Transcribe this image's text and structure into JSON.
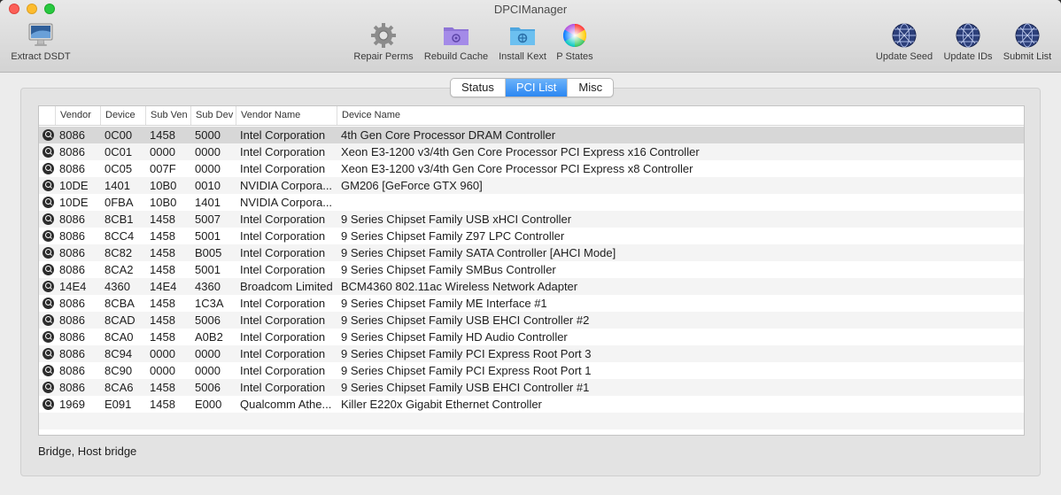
{
  "window": {
    "title": "DPCIManager"
  },
  "toolbar": {
    "extract": "Extract DSDT",
    "repair": "Repair Perms",
    "rebuild": "Rebuild Cache",
    "install": "Install Kext",
    "pstates": "P States",
    "update_seed": "Update Seed",
    "update_ids": "Update IDs",
    "submit": "Submit List"
  },
  "tabs": [
    "Status",
    "PCI List",
    "Misc"
  ],
  "active_tab": "PCI List",
  "table": {
    "columns": [
      "Vendor",
      "Device",
      "Sub Ven",
      "Sub Dev",
      "Vendor Name",
      "Device Name"
    ],
    "rows": [
      [
        "8086",
        "0C00",
        "1458",
        "5000",
        "Intel Corporation",
        "4th Gen Core Processor DRAM Controller"
      ],
      [
        "8086",
        "0C01",
        "0000",
        "0000",
        "Intel Corporation",
        "Xeon E3-1200 v3/4th Gen Core Processor PCI Express x16 Controller"
      ],
      [
        "8086",
        "0C05",
        "007F",
        "0000",
        "Intel Corporation",
        "Xeon E3-1200 v3/4th Gen Core Processor PCI Express x8 Controller"
      ],
      [
        "10DE",
        "1401",
        "10B0",
        "0010",
        "NVIDIA Corpora...",
        "GM206 [GeForce GTX 960]"
      ],
      [
        "10DE",
        "0FBA",
        "10B0",
        "1401",
        "NVIDIA Corpora...",
        ""
      ],
      [
        "8086",
        "8CB1",
        "1458",
        "5007",
        "Intel Corporation",
        "9 Series Chipset Family USB xHCI Controller"
      ],
      [
        "8086",
        "8CC4",
        "1458",
        "5001",
        "Intel Corporation",
        "9 Series Chipset Family Z97 LPC Controller"
      ],
      [
        "8086",
        "8C82",
        "1458",
        "B005",
        "Intel Corporation",
        "9 Series Chipset Family SATA Controller [AHCI Mode]"
      ],
      [
        "8086",
        "8CA2",
        "1458",
        "5001",
        "Intel Corporation",
        "9 Series Chipset Family SMBus Controller"
      ],
      [
        "14E4",
        "4360",
        "14E4",
        "4360",
        "Broadcom Limited",
        "BCM4360 802.11ac Wireless Network Adapter"
      ],
      [
        "8086",
        "8CBA",
        "1458",
        "1C3A",
        "Intel Corporation",
        "9 Series Chipset Family ME Interface #1"
      ],
      [
        "8086",
        "8CAD",
        "1458",
        "5006",
        "Intel Corporation",
        "9 Series Chipset Family USB EHCI Controller #2"
      ],
      [
        "8086",
        "8CA0",
        "1458",
        "A0B2",
        "Intel Corporation",
        "9 Series Chipset Family HD Audio Controller"
      ],
      [
        "8086",
        "8C94",
        "0000",
        "0000",
        "Intel Corporation",
        "9 Series Chipset Family PCI Express Root Port 3"
      ],
      [
        "8086",
        "8C90",
        "0000",
        "0000",
        "Intel Corporation",
        "9 Series Chipset Family PCI Express Root Port 1"
      ],
      [
        "8086",
        "8CA6",
        "1458",
        "5006",
        "Intel Corporation",
        "9 Series Chipset Family USB EHCI Controller #1"
      ],
      [
        "1969",
        "E091",
        "1458",
        "E000",
        "Qualcomm Athe...",
        "Killer E220x Gigabit Ethernet Controller"
      ]
    ],
    "selected_row": 0
  },
  "status_text": "Bridge, Host bridge"
}
